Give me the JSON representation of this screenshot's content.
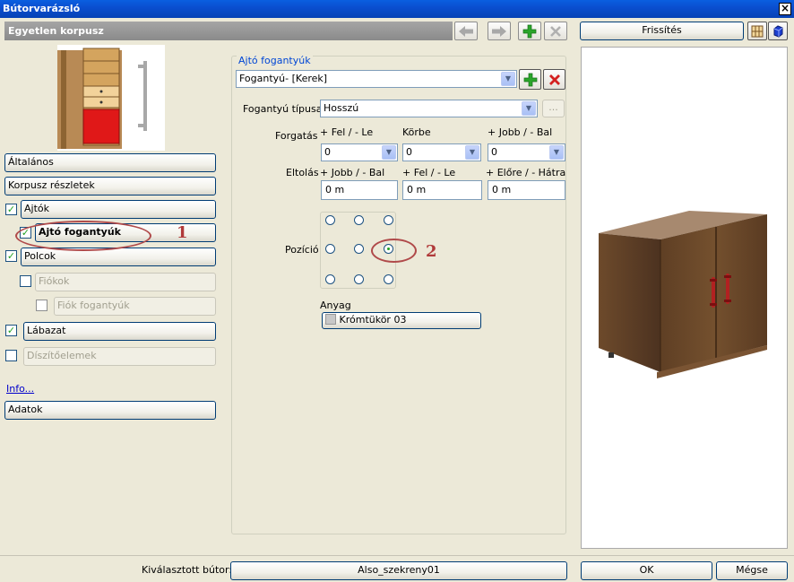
{
  "window": {
    "title": "Bútorvarázsló",
    "close_glyph": "×"
  },
  "header": {
    "title": "Egyetlen korpusz"
  },
  "toolbar": {
    "back_icon": "arrow-left-icon",
    "forward_icon": "arrow-right-icon",
    "add_icon": "plus-icon",
    "delete_icon": "x-icon",
    "accent_green": "#2aa52a",
    "accent_red": "#d42020"
  },
  "sidebar": {
    "items": [
      {
        "label": "Általános",
        "checkbox": null,
        "enabled": true
      },
      {
        "label": "Korpusz részletek",
        "checkbox": null,
        "enabled": true
      },
      {
        "label": "Ajtók",
        "checkbox": true,
        "enabled": true
      },
      {
        "label": "Ajtó fogantyúk",
        "checkbox": true,
        "enabled": true,
        "selected": true
      },
      {
        "label": "Polcok",
        "checkbox": true,
        "enabled": true
      },
      {
        "label": "Fiókok",
        "checkbox": false,
        "enabled": false
      },
      {
        "label": "Fiók fogantyúk",
        "checkbox": false,
        "enabled": false
      },
      {
        "label": "Lábazat",
        "checkbox": true,
        "enabled": true
      },
      {
        "label": "Díszítőelemek",
        "checkbox": false,
        "enabled": false
      }
    ],
    "info_link": "Info...",
    "data_button": "Adatok"
  },
  "group": {
    "title": "Ajtó fogantyúk",
    "handle_select": "Fogantyú- [Kerek]",
    "type_label": "Fogantyú típusa",
    "type_value": "Hosszú",
    "type_more": "...",
    "rotation_label": "Forgatás",
    "rotation": [
      {
        "header": "+ Fel / - Le",
        "value": "0"
      },
      {
        "header": "Körbe",
        "value": "0"
      },
      {
        "header": "+ Jobb / - Bal",
        "value": "0"
      }
    ],
    "offset_label": "Eltolás",
    "offset": [
      {
        "header": "+ Jobb / - Bal",
        "value": "0 m"
      },
      {
        "header": "+ Fel / - Le",
        "value": "0 m"
      },
      {
        "header": "+ Előre / - Hátra",
        "value": "0 m"
      }
    ],
    "position_label": "Pozíció",
    "position_selected": "middle-right",
    "material_label": "Anyag",
    "material_value": "Krómtükör 03"
  },
  "annotations": {
    "one": "1",
    "two": "2"
  },
  "preview": {
    "refresh_button": "Frissítés"
  },
  "footer": {
    "selected_label": "Kiválasztott bútor:",
    "selected_value": "Also_szekreny01",
    "ok": "OK",
    "cancel": "Mégse"
  }
}
